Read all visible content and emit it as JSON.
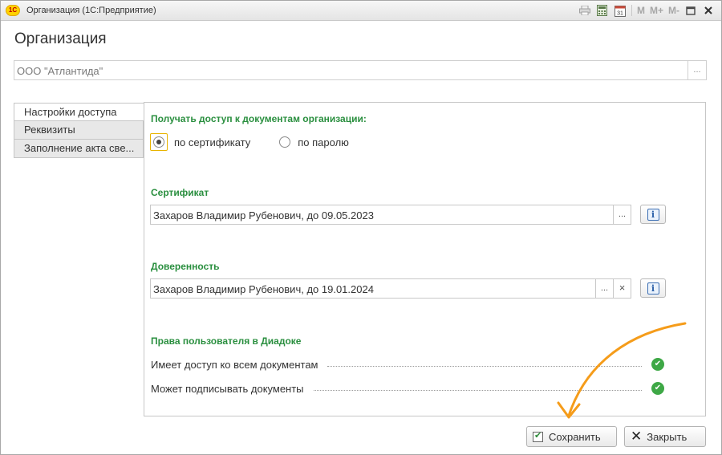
{
  "window": {
    "title": "Организация (1С:Предприятие)",
    "logo": "1С",
    "toolbar": {
      "icons": [
        "print-icon",
        "calculator-icon",
        "calendar-icon"
      ],
      "calendar_day": "31",
      "m_labels": [
        "M",
        "M+",
        "M-"
      ]
    }
  },
  "form": {
    "title": "Организация",
    "organization_value": "ООО \"Атлантида\"",
    "organization_button": "..."
  },
  "tabs": [
    {
      "label": "Настройки доступа",
      "active": true
    },
    {
      "label": "Реквизиты",
      "active": false
    },
    {
      "label": "Заполнение акта све...",
      "active": false
    }
  ],
  "access": {
    "heading": "Получать доступ к документам организации:",
    "options": [
      {
        "label": "по сертификату",
        "selected": true
      },
      {
        "label": "по паролю",
        "selected": false
      }
    ]
  },
  "certificate": {
    "heading": "Сертификат",
    "value": "Захаров Владимир Рубенович, до 09.05.2023",
    "select_button": "..."
  },
  "power_of_attorney": {
    "heading": "Доверенность",
    "value": "Захаров Владимир Рубенович, до 19.01.2024",
    "select_button": "...",
    "clear_button": "×"
  },
  "rights": {
    "heading": "Права пользователя в Диадоке",
    "items": [
      {
        "label": "Имеет доступ ко всем документам",
        "status": "ok"
      },
      {
        "label": "Может подписывать документы",
        "status": "ok"
      }
    ]
  },
  "buttons": {
    "save": "Сохранить",
    "close": "Закрыть"
  },
  "colors": {
    "accent_green": "#2a8f3f",
    "check_green": "#3ea846",
    "annotation_arrow": "#f59c1a",
    "focus_frame": "#e8b400"
  }
}
